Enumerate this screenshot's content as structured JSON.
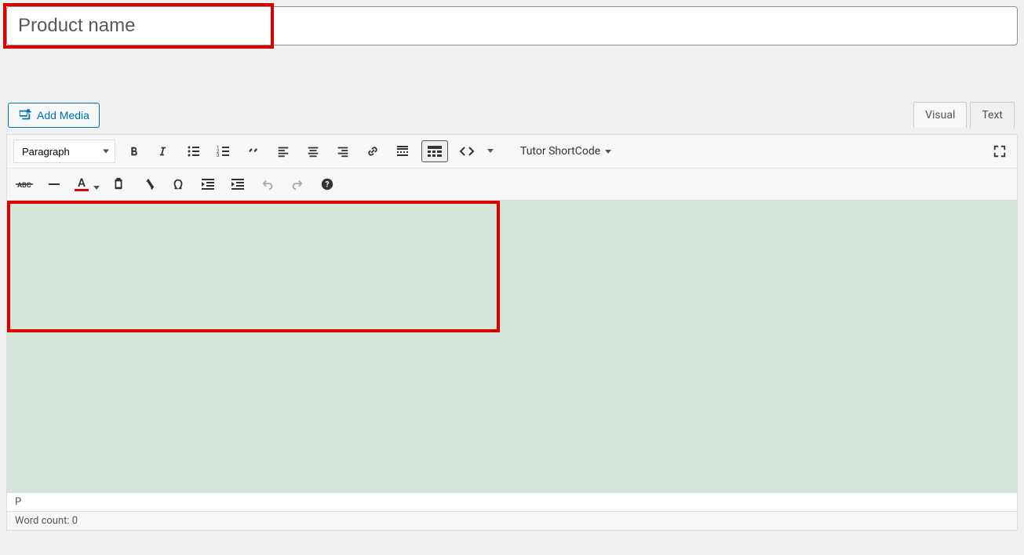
{
  "title": {
    "placeholder": "Product name"
  },
  "buttons": {
    "add_media": "Add Media",
    "tutor_shortcode": "Tutor ShortCode"
  },
  "tabs": {
    "visual": "Visual",
    "text": "Text"
  },
  "format_select": {
    "value": "Paragraph"
  },
  "textcolor": {
    "letter": "A"
  },
  "path_bar": "P",
  "status_bar": "Word count: 0"
}
